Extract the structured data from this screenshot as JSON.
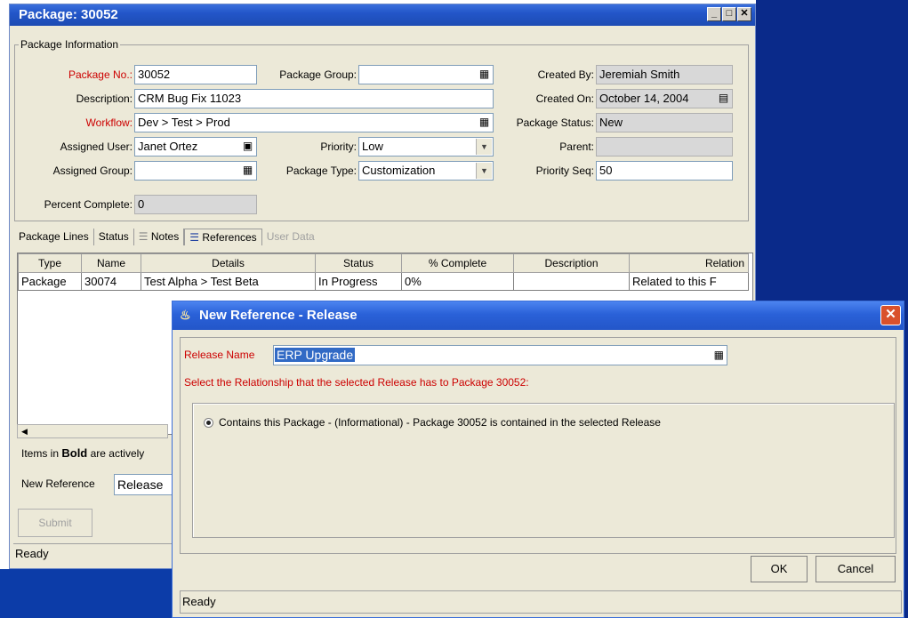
{
  "window": {
    "title": "Package: 30052"
  },
  "package_info": {
    "legend": "Package Information",
    "package_no_label": "Package No.:",
    "package_no": "30052",
    "description_label": "Description:",
    "description": "CRM Bug Fix 11023",
    "workflow_label": "Workflow:",
    "workflow": "Dev > Test > Prod",
    "assigned_user_label": "Assigned User:",
    "assigned_user": "Janet Ortez",
    "assigned_group_label": "Assigned Group:",
    "assigned_group": "",
    "percent_complete_label": "Percent Complete:",
    "percent_complete": "0",
    "package_group_label": "Package Group:",
    "package_group": "",
    "priority_label": "Priority:",
    "priority": "Low",
    "package_type_label": "Package Type:",
    "package_type": "Customization",
    "created_by_label": "Created By:",
    "created_by": "Jeremiah Smith",
    "created_on_label": "Created On:",
    "created_on": "October 14, 2004",
    "package_status_label": "Package Status:",
    "package_status": "New",
    "parent_label": "Parent:",
    "parent": "",
    "priority_seq_label": "Priority Seq:",
    "priority_seq": "50"
  },
  "tabs": [
    "Package Lines",
    "Status",
    "Notes",
    "References",
    "User Data"
  ],
  "references_table": {
    "columns": [
      "Type",
      "Name",
      "Details",
      "Status",
      "% Complete",
      "Description",
      "Relation"
    ],
    "rows": [
      [
        "Package",
        "30074",
        "Test Alpha > Test Beta",
        "In Progress",
        "0%",
        "",
        "Related to this F"
      ]
    ]
  },
  "bold_note": {
    "prefix": "Items in",
    "bold": "Bold",
    "suffix": "are actively"
  },
  "new_reference": {
    "label": "New Reference",
    "value": "Release"
  },
  "submit_label": "Submit",
  "status": "Ready",
  "dialog": {
    "title": "New Reference - Release",
    "release_name_label": "Release Name",
    "release_name": "ERP Upgrade",
    "instruction": "Select the Relationship that the selected Release has to Package 30052:",
    "option": "Contains this Package - (Informational) - Package 30052 is contained in the selected Release",
    "ok_label": "OK",
    "cancel_label": "Cancel",
    "status": "Ready"
  }
}
